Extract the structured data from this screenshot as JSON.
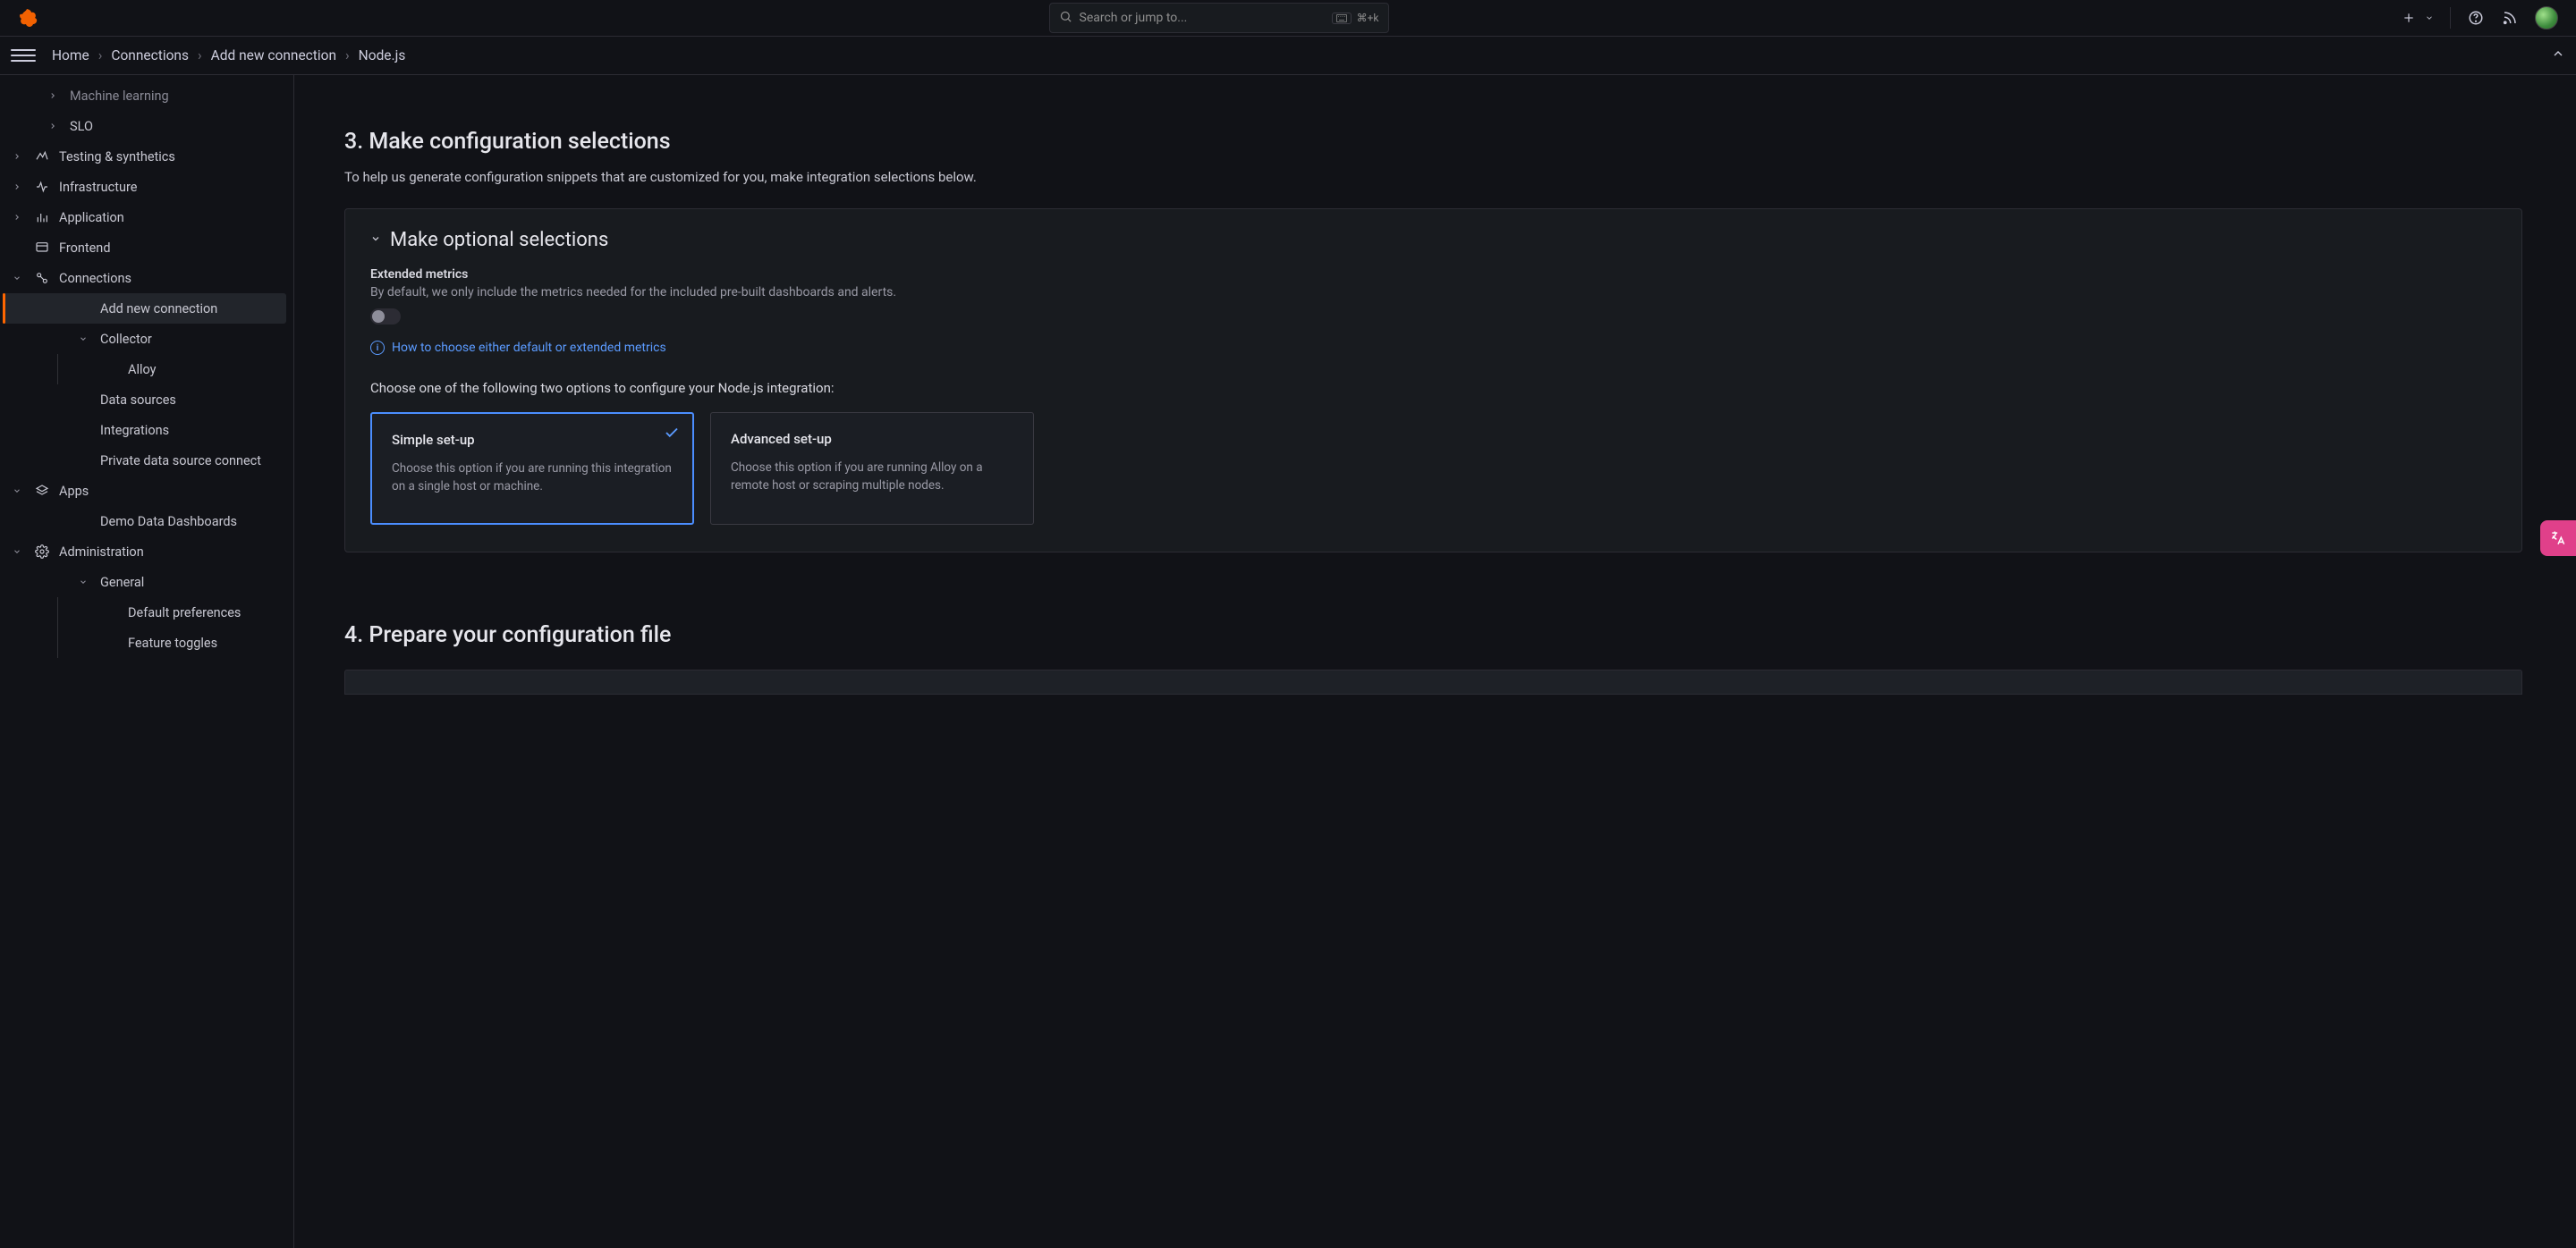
{
  "header": {
    "search_placeholder": "Search or jump to...",
    "shortcut": "⌘+k"
  },
  "breadcrumbs": [
    "Home",
    "Connections",
    "Add new connection",
    "Node.js"
  ],
  "sidebar": {
    "items": [
      {
        "label": "Machine learning",
        "indent": 2,
        "chevron": "right",
        "dim": true
      },
      {
        "label": "SLO",
        "indent": 2,
        "chevron": "right"
      },
      {
        "label": "Testing & synthetics",
        "indent": 1,
        "chevron": "right",
        "icon": "synthetics"
      },
      {
        "label": "Infrastructure",
        "indent": 1,
        "chevron": "right",
        "icon": "infra"
      },
      {
        "label": "Application",
        "indent": 1,
        "chevron": "right",
        "icon": "app"
      },
      {
        "label": "Frontend",
        "indent": 1,
        "chevron": "none",
        "icon": "frontend"
      },
      {
        "label": "Connections",
        "indent": 1,
        "chevron": "down",
        "icon": "connections"
      },
      {
        "label": "Add new connection",
        "indent": 3,
        "chevron": "none",
        "active": true
      },
      {
        "label": "Collector",
        "indent": 3,
        "chevron": "down"
      },
      {
        "label": "Alloy",
        "indent": 4,
        "chevron": "none",
        "tree": true
      },
      {
        "label": "Data sources",
        "indent": 3,
        "chevron": "none"
      },
      {
        "label": "Integrations",
        "indent": 3,
        "chevron": "none"
      },
      {
        "label": "Private data source connect",
        "indent": 3,
        "chevron": "none"
      },
      {
        "label": "Apps",
        "indent": 1,
        "chevron": "down",
        "icon": "apps"
      },
      {
        "label": "Demo Data Dashboards",
        "indent": 3,
        "chevron": "none"
      },
      {
        "label": "Administration",
        "indent": 1,
        "chevron": "down",
        "icon": "admin"
      },
      {
        "label": "General",
        "indent": 3,
        "chevron": "down"
      },
      {
        "label": "Default preferences",
        "indent": 4,
        "chevron": "none",
        "tree": true
      },
      {
        "label": "Feature toggles",
        "indent": 4,
        "chevron": "none",
        "tree": true
      }
    ]
  },
  "main": {
    "section3_title": "3. Make configuration selections",
    "section3_sub": "To help us generate configuration snippets that are customized for you, make integration selections below.",
    "panel_title": "Make optional selections",
    "extended_label": "Extended metrics",
    "extended_desc": "By default, we only include the metrics needed for the included pre-built dashboards and alerts.",
    "info_link": "How to choose either default or extended metrics",
    "choose_text": "Choose one of the following two options to configure your Node.js integration:",
    "option1_title": "Simple set-up",
    "option1_desc": "Choose this option if you are running this integration on a single host or machine.",
    "option2_title": "Advanced set-up",
    "option2_desc": "Choose this option if you are running Alloy on a remote host or scraping multiple nodes.",
    "section4_title": "4. Prepare your configuration file"
  }
}
